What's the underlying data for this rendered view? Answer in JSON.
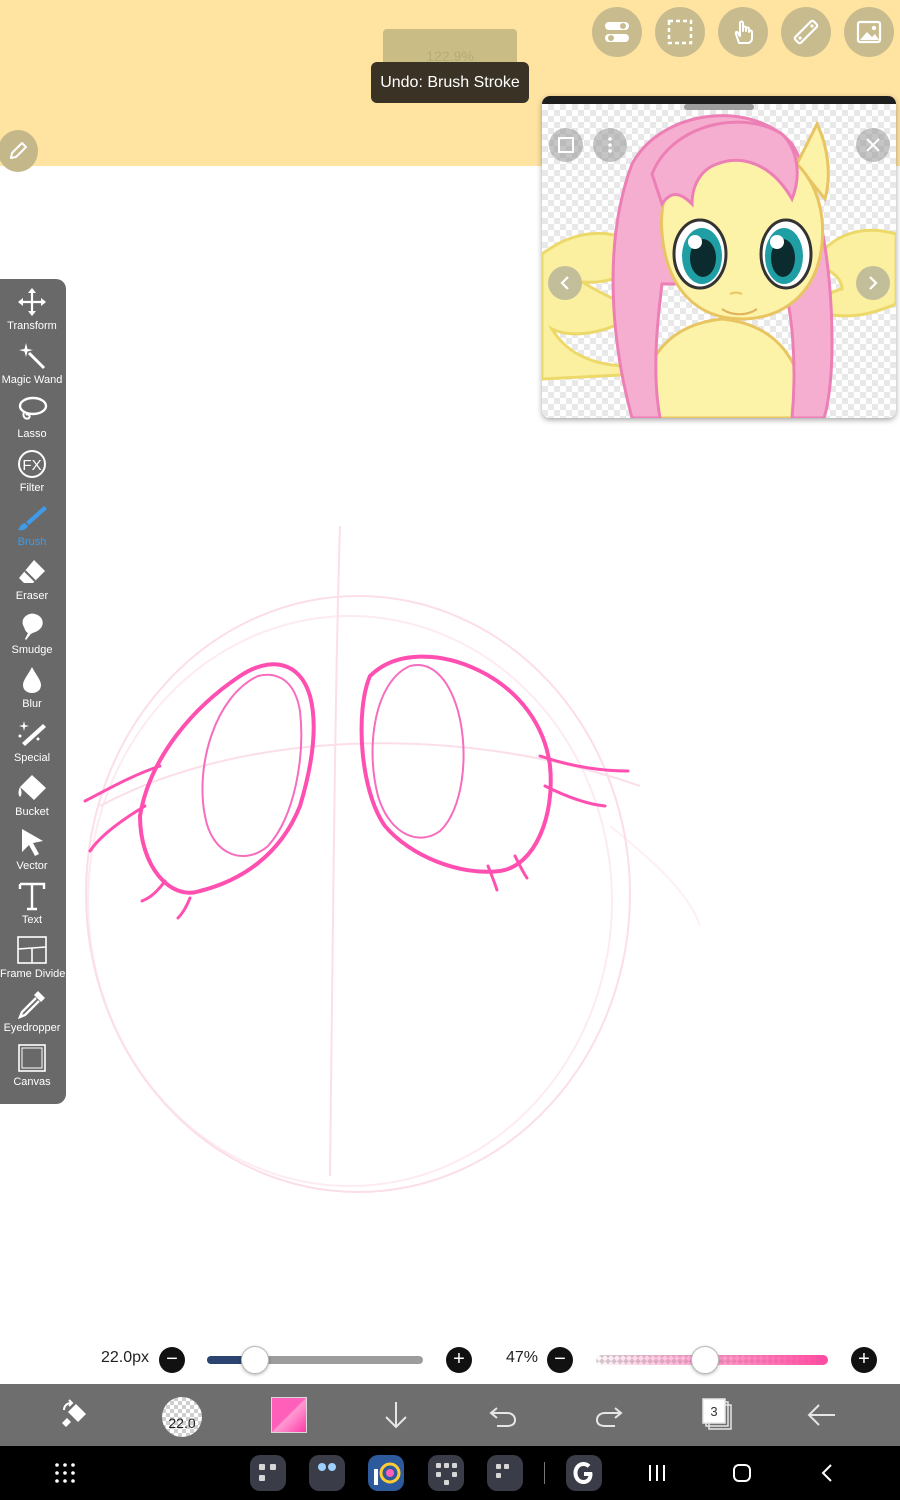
{
  "top": {
    "zoom_label": "122.9%",
    "toast": "Undo: Brush Stroke",
    "buttons": [
      "toggle-icon",
      "selection-icon",
      "hand-gesture-icon",
      "ruler-icon",
      "reference-image-icon"
    ]
  },
  "colors": {
    "top_bg": "#fee3a1",
    "toolbar_bg": "#696969",
    "active_tool": "#3d9be9",
    "stroke_pink": "#ff4fb0",
    "bottom_bar": "#6e6e6e"
  },
  "tools": [
    {
      "id": "transform",
      "label": "Transform"
    },
    {
      "id": "magic-wand",
      "label": "Magic Wand"
    },
    {
      "id": "lasso",
      "label": "Lasso"
    },
    {
      "id": "filter",
      "label": "Filter"
    },
    {
      "id": "brush",
      "label": "Brush",
      "active": true
    },
    {
      "id": "eraser",
      "label": "Eraser"
    },
    {
      "id": "smudge",
      "label": "Smudge"
    },
    {
      "id": "blur",
      "label": "Blur"
    },
    {
      "id": "special",
      "label": "Special"
    },
    {
      "id": "bucket",
      "label": "Bucket"
    },
    {
      "id": "vector",
      "label": "Vector"
    },
    {
      "id": "text",
      "label": "Text"
    },
    {
      "id": "frame-divider",
      "label": "Frame Divider"
    },
    {
      "id": "eyedropper",
      "label": "Eyedropper"
    },
    {
      "id": "canvas",
      "label": "Canvas"
    }
  ],
  "sliders": {
    "size_label": "22.0px",
    "size_fraction": 0.22,
    "opacity_label": "47%",
    "opacity_fraction": 0.47,
    "minus": "−",
    "plus": "+"
  },
  "bottom": {
    "brush_size": "22.0",
    "layer_count": "3"
  }
}
